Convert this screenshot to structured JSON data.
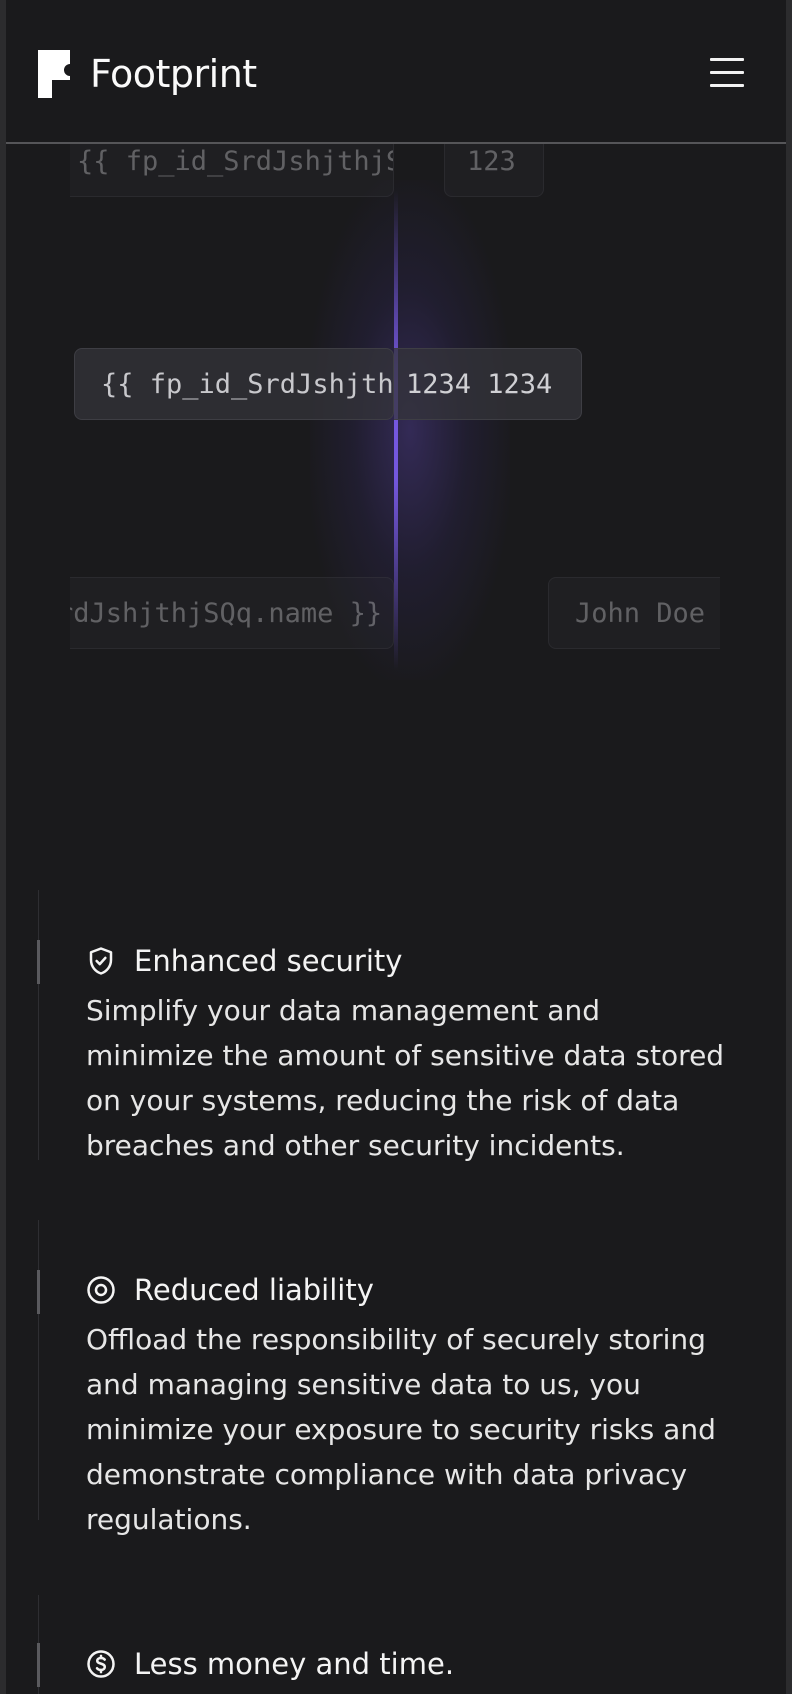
{
  "header": {
    "brand": "Footprint",
    "menu_icon": "hamburger-menu-icon"
  },
  "hero": {
    "chips": [
      {
        "text": "{{ fp_id_SrdJshjthjSQq.",
        "icon": ""
      },
      {
        "text": "123"
      },
      {
        "text": "{{ fp_id_SrdJshjth"
      },
      {
        "text": "1234 1234"
      },
      {
        "text": "rdJshjthjSQq.name }}"
      },
      {
        "text": "John Doe"
      }
    ]
  },
  "features": [
    {
      "icon": "shield-check-icon",
      "title": "Enhanced security",
      "body": "Simplify your data management and minimize the amount of sensitive data stored on your systems, reducing the risk of data breaches and other security incidents."
    },
    {
      "icon": "eye-target-icon",
      "title": "Reduced liability",
      "body": "Offload the responsibility of securely storing and managing sensitive data to us, you minimize your exposure to security risks and demonstrate compliance with data privacy regulations."
    },
    {
      "icon": "dollar-circle-icon",
      "title": "Less money and time."
    }
  ],
  "colors": {
    "background": "#1a1a1c",
    "accent_beam": "#785ae6"
  }
}
